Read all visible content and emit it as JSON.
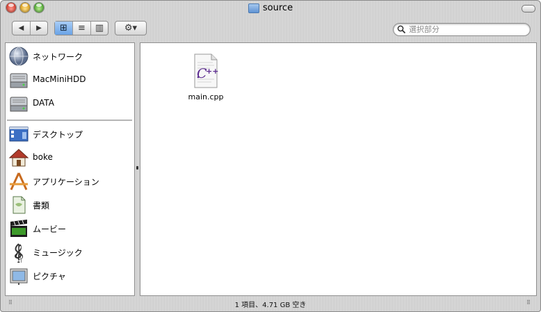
{
  "window": {
    "title": "source"
  },
  "toolbar": {
    "back_glyph": "◀",
    "forward_glyph": "▶",
    "view_icons_glyph": "⊞",
    "view_list_glyph": "≡",
    "view_columns_glyph": "▥",
    "action_glyph": "⚙▾",
    "active_view": "icons"
  },
  "search": {
    "placeholder": "選択部分",
    "value": ""
  },
  "sidebar": {
    "devices": [
      {
        "label": "ネットワーク",
        "icon": "network-globe-icon"
      },
      {
        "label": "MacMiniHDD",
        "icon": "hard-drive-icon"
      },
      {
        "label": "DATA",
        "icon": "hard-drive-icon"
      }
    ],
    "places": [
      {
        "label": "デスクトップ",
        "icon": "desktop-icon"
      },
      {
        "label": "boke",
        "icon": "home-icon"
      },
      {
        "label": "アプリケーション",
        "icon": "applications-icon"
      },
      {
        "label": "書類",
        "icon": "documents-icon"
      },
      {
        "label": "ムービー",
        "icon": "movies-clapper-icon"
      },
      {
        "label": "ミュージック",
        "icon": "music-clef-icon"
      },
      {
        "label": "ピクチャ",
        "icon": "pictures-icon"
      }
    ]
  },
  "files": [
    {
      "name": "main.cpp",
      "icon": "cpp-file-icon"
    }
  ],
  "status": {
    "text": "1 項目、4.71 GB 空き"
  },
  "colors": {
    "selected_view": "#6aa3e6",
    "window_metal": "#d2d2d2"
  }
}
